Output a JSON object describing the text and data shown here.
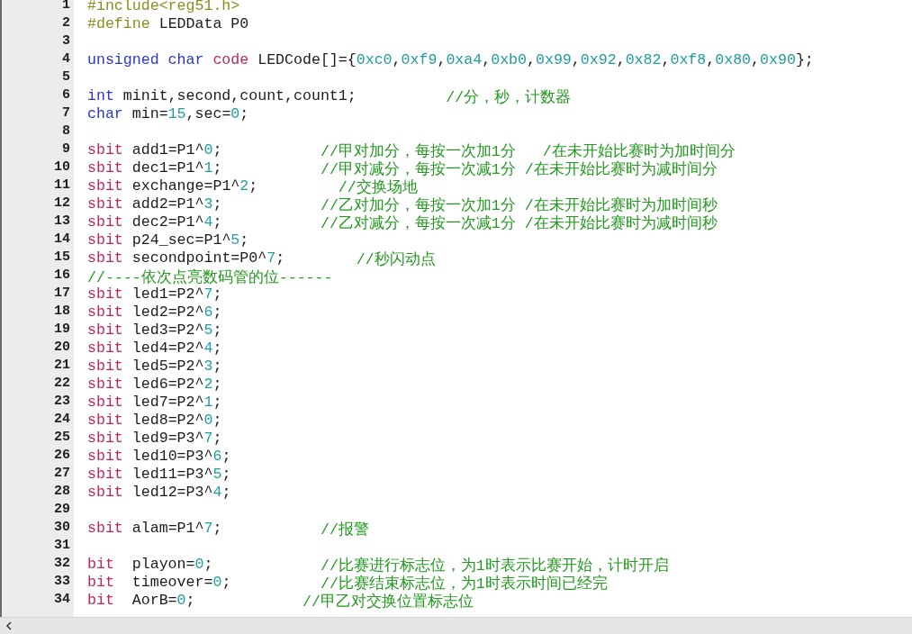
{
  "editor": {
    "lines": [
      {
        "number": "1",
        "tokens": [
          {
            "kind": "pp",
            "text": "#include<reg51.h>"
          }
        ]
      },
      {
        "number": "2",
        "tokens": [
          {
            "kind": "pp",
            "text": "#define"
          },
          {
            "kind": "plain",
            "text": " LEDData P0"
          }
        ]
      },
      {
        "number": "3"
      },
      {
        "number": "4",
        "tokens": [
          {
            "kind": "kw",
            "text": "unsigned char"
          },
          {
            "kind": "kw2",
            "text": " code"
          },
          {
            "kind": "plain",
            "text": " LEDCode[]={"
          },
          {
            "kind": "num",
            "text": "0xc0"
          },
          {
            "kind": "plain",
            "text": ","
          },
          {
            "kind": "num",
            "text": "0xf9"
          },
          {
            "kind": "plain",
            "text": ","
          },
          {
            "kind": "num",
            "text": "0xa4"
          },
          {
            "kind": "plain",
            "text": ","
          },
          {
            "kind": "num",
            "text": "0xb0"
          },
          {
            "kind": "plain",
            "text": ","
          },
          {
            "kind": "num",
            "text": "0x99"
          },
          {
            "kind": "plain",
            "text": ","
          },
          {
            "kind": "num",
            "text": "0x92"
          },
          {
            "kind": "plain",
            "text": ","
          },
          {
            "kind": "num",
            "text": "0x82"
          },
          {
            "kind": "plain",
            "text": ","
          },
          {
            "kind": "num",
            "text": "0xf8"
          },
          {
            "kind": "plain",
            "text": ","
          },
          {
            "kind": "num",
            "text": "0x80"
          },
          {
            "kind": "plain",
            "text": ","
          },
          {
            "kind": "num",
            "text": "0x90"
          },
          {
            "kind": "plain",
            "text": "};"
          }
        ]
      },
      {
        "number": "5"
      },
      {
        "number": "6",
        "tokens": [
          {
            "kind": "kw",
            "text": "int"
          },
          {
            "kind": "plain",
            "text": " minit,second,count,count1;          "
          }
        ],
        "comment": "//分，秒，计数器"
      },
      {
        "number": "7",
        "tokens": [
          {
            "kind": "kw",
            "text": "char"
          },
          {
            "kind": "plain",
            "text": " min="
          },
          {
            "kind": "num",
            "text": "15"
          },
          {
            "kind": "plain",
            "text": ",sec="
          },
          {
            "kind": "num",
            "text": "0"
          },
          {
            "kind": "plain",
            "text": ";"
          }
        ]
      },
      {
        "number": "8"
      },
      {
        "number": "9",
        "tokens": [
          {
            "kind": "kw2",
            "text": "sbit"
          },
          {
            "kind": "plain",
            "text": " add1=P1^"
          },
          {
            "kind": "num",
            "text": "0"
          },
          {
            "kind": "plain",
            "text": ";           "
          }
        ],
        "comment": "//甲对加分，每按一次加1分   /在未开始比赛时为加时间分"
      },
      {
        "number": "10",
        "tokens": [
          {
            "kind": "kw2",
            "text": "sbit"
          },
          {
            "kind": "plain",
            "text": " dec1=P1^"
          },
          {
            "kind": "num",
            "text": "1"
          },
          {
            "kind": "plain",
            "text": ";           "
          }
        ],
        "comment": "//甲对减分，每按一次减1分 /在未开始比赛时为减时间分"
      },
      {
        "number": "11",
        "tokens": [
          {
            "kind": "kw2",
            "text": "sbit"
          },
          {
            "kind": "plain",
            "text": " exchange=P1^"
          },
          {
            "kind": "num",
            "text": "2"
          },
          {
            "kind": "plain",
            "text": ";         "
          }
        ],
        "comment": "//交换场地"
      },
      {
        "number": "12",
        "tokens": [
          {
            "kind": "kw2",
            "text": "sbit"
          },
          {
            "kind": "plain",
            "text": " add2=P1^"
          },
          {
            "kind": "num",
            "text": "3"
          },
          {
            "kind": "plain",
            "text": ";           "
          }
        ],
        "comment": "//乙对加分，每按一次加1分 /在未开始比赛时为加时间秒"
      },
      {
        "number": "13",
        "tokens": [
          {
            "kind": "kw2",
            "text": "sbit"
          },
          {
            "kind": "plain",
            "text": " dec2=P1^"
          },
          {
            "kind": "num",
            "text": "4"
          },
          {
            "kind": "plain",
            "text": ";           "
          }
        ],
        "comment": "//乙对减分，每按一次减1分 /在未开始比赛时为减时间秒"
      },
      {
        "number": "14",
        "tokens": [
          {
            "kind": "kw2",
            "text": "sbit"
          },
          {
            "kind": "plain",
            "text": " p24_sec=P1^"
          },
          {
            "kind": "num",
            "text": "5"
          },
          {
            "kind": "plain",
            "text": ";"
          }
        ]
      },
      {
        "number": "15",
        "tokens": [
          {
            "kind": "kw2",
            "text": "sbit"
          },
          {
            "kind": "plain",
            "text": " secondpoint=P0^"
          },
          {
            "kind": "num",
            "text": "7"
          },
          {
            "kind": "plain",
            "text": ";        "
          }
        ],
        "comment": "//秒闪动点"
      },
      {
        "number": "16",
        "comment": "//----依次点亮数码管的位------"
      },
      {
        "number": "17",
        "tokens": [
          {
            "kind": "kw2",
            "text": "sbit"
          },
          {
            "kind": "plain",
            "text": " led1=P2^"
          },
          {
            "kind": "num",
            "text": "7"
          },
          {
            "kind": "plain",
            "text": ";"
          }
        ]
      },
      {
        "number": "18",
        "tokens": [
          {
            "kind": "kw2",
            "text": "sbit"
          },
          {
            "kind": "plain",
            "text": " led2=P2^"
          },
          {
            "kind": "num",
            "text": "6"
          },
          {
            "kind": "plain",
            "text": ";"
          }
        ]
      },
      {
        "number": "19",
        "tokens": [
          {
            "kind": "kw2",
            "text": "sbit"
          },
          {
            "kind": "plain",
            "text": " led3=P2^"
          },
          {
            "kind": "num",
            "text": "5"
          },
          {
            "kind": "plain",
            "text": ";"
          }
        ]
      },
      {
        "number": "20",
        "tokens": [
          {
            "kind": "kw2",
            "text": "sbit"
          },
          {
            "kind": "plain",
            "text": " led4=P2^"
          },
          {
            "kind": "num",
            "text": "4"
          },
          {
            "kind": "plain",
            "text": ";"
          }
        ]
      },
      {
        "number": "21",
        "tokens": [
          {
            "kind": "kw2",
            "text": "sbit"
          },
          {
            "kind": "plain",
            "text": " led5=P2^"
          },
          {
            "kind": "num",
            "text": "3"
          },
          {
            "kind": "plain",
            "text": ";"
          }
        ]
      },
      {
        "number": "22",
        "tokens": [
          {
            "kind": "kw2",
            "text": "sbit"
          },
          {
            "kind": "plain",
            "text": " led6=P2^"
          },
          {
            "kind": "num",
            "text": "2"
          },
          {
            "kind": "plain",
            "text": ";"
          }
        ]
      },
      {
        "number": "23",
        "tokens": [
          {
            "kind": "kw2",
            "text": "sbit"
          },
          {
            "kind": "plain",
            "text": " led7=P2^"
          },
          {
            "kind": "num",
            "text": "1"
          },
          {
            "kind": "plain",
            "text": ";"
          }
        ]
      },
      {
        "number": "24",
        "tokens": [
          {
            "kind": "kw2",
            "text": "sbit"
          },
          {
            "kind": "plain",
            "text": " led8=P2^"
          },
          {
            "kind": "num",
            "text": "0"
          },
          {
            "kind": "plain",
            "text": ";"
          }
        ]
      },
      {
        "number": "25",
        "tokens": [
          {
            "kind": "kw2",
            "text": "sbit"
          },
          {
            "kind": "plain",
            "text": " led9=P3^"
          },
          {
            "kind": "num",
            "text": "7"
          },
          {
            "kind": "plain",
            "text": ";"
          }
        ]
      },
      {
        "number": "26",
        "tokens": [
          {
            "kind": "kw2",
            "text": "sbit"
          },
          {
            "kind": "plain",
            "text": " led10=P3^"
          },
          {
            "kind": "num",
            "text": "6"
          },
          {
            "kind": "plain",
            "text": ";"
          }
        ]
      },
      {
        "number": "27",
        "tokens": [
          {
            "kind": "kw2",
            "text": "sbit"
          },
          {
            "kind": "plain",
            "text": " led11=P3^"
          },
          {
            "kind": "num",
            "text": "5"
          },
          {
            "kind": "plain",
            "text": ";"
          }
        ]
      },
      {
        "number": "28",
        "tokens": [
          {
            "kind": "kw2",
            "text": "sbit"
          },
          {
            "kind": "plain",
            "text": " led12=P3^"
          },
          {
            "kind": "num",
            "text": "4"
          },
          {
            "kind": "plain",
            "text": ";"
          }
        ]
      },
      {
        "number": "29"
      },
      {
        "number": "30",
        "tokens": [
          {
            "kind": "kw2",
            "text": "sbit"
          },
          {
            "kind": "plain",
            "text": " alam=P1^"
          },
          {
            "kind": "num",
            "text": "7"
          },
          {
            "kind": "plain",
            "text": ";           "
          }
        ],
        "comment": "//报警"
      },
      {
        "number": "31"
      },
      {
        "number": "32",
        "tokens": [
          {
            "kind": "kw2",
            "text": "bit"
          },
          {
            "kind": "plain",
            "text": "  playon="
          },
          {
            "kind": "num",
            "text": "0"
          },
          {
            "kind": "plain",
            "text": ";            "
          }
        ],
        "comment": "//比赛进行标志位，为1时表示比赛开始，计时开启"
      },
      {
        "number": "33",
        "tokens": [
          {
            "kind": "kw2",
            "text": "bit"
          },
          {
            "kind": "plain",
            "text": "  timeover="
          },
          {
            "kind": "num",
            "text": "0"
          },
          {
            "kind": "plain",
            "text": ";          "
          }
        ],
        "comment": "//比赛结束标志位，为1时表示时间已经完"
      },
      {
        "number": "34",
        "tokens": [
          {
            "kind": "kw2",
            "text": "bit"
          },
          {
            "kind": "plain",
            "text": "  AorB="
          },
          {
            "kind": "num",
            "text": "0"
          },
          {
            "kind": "plain",
            "text": ";            "
          }
        ],
        "comment": "//甲乙对交换位置标志位"
      }
    ]
  }
}
